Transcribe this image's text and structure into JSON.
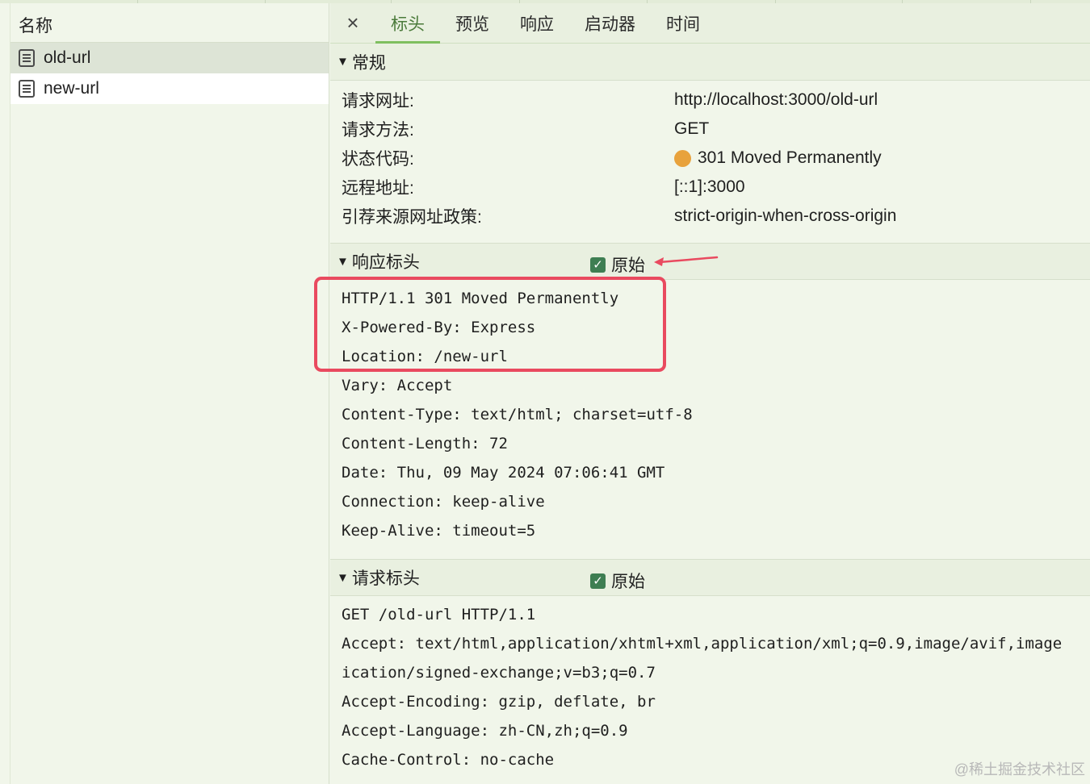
{
  "name_panel": {
    "header": "名称",
    "items": [
      {
        "label": "old-url",
        "icon": "document-icon",
        "selected": true
      },
      {
        "label": "new-url",
        "icon": "document-icon",
        "selected": false
      }
    ]
  },
  "tabs": {
    "close_icon": "×",
    "items": [
      {
        "label": "标头",
        "active": true
      },
      {
        "label": "预览",
        "active": false
      },
      {
        "label": "响应",
        "active": false
      },
      {
        "label": "启动器",
        "active": false
      },
      {
        "label": "时间",
        "active": false
      }
    ]
  },
  "general": {
    "title": "常规",
    "rows": [
      {
        "key": "请求网址:",
        "value": "http://localhost:3000/old-url"
      },
      {
        "key": "请求方法:",
        "value": "GET"
      },
      {
        "key": "状态代码:",
        "value": "301 Moved Permanently",
        "status_color": "#e8a23c"
      },
      {
        "key": "远程地址:",
        "value": "[::1]:3000"
      },
      {
        "key": "引荐来源网址政策:",
        "value": "strict-origin-when-cross-origin"
      }
    ]
  },
  "response_headers": {
    "title": "响应标头",
    "raw_label": "原始",
    "raw_checked": true,
    "lines": [
      "HTTP/1.1 301 Moved Permanently",
      "X-Powered-By: Express",
      "Location: /new-url",
      "Vary: Accept",
      "Content-Type: text/html; charset=utf-8",
      "Content-Length: 72",
      "Date: Thu, 09 May 2024 07:06:41 GMT",
      "Connection: keep-alive",
      "Keep-Alive: timeout=5"
    ]
  },
  "request_headers": {
    "title": "请求标头",
    "raw_label": "原始",
    "raw_checked": true,
    "lines": [
      "GET /old-url HTTP/1.1",
      "Accept: text/html,application/xhtml+xml,application/xml;q=0.9,image/avif,image",
      "ication/signed-exchange;v=b3;q=0.7",
      "Accept-Encoding: gzip, deflate, br",
      "Accept-Language: zh-CN,zh;q=0.9",
      "Cache-Control: no-cache"
    ]
  },
  "watermark": "@稀土掘金技术社区",
  "colors": {
    "accent": "#7fbf5f",
    "highlight_box": "#e94a5f",
    "checkbox": "#3e7e52"
  }
}
